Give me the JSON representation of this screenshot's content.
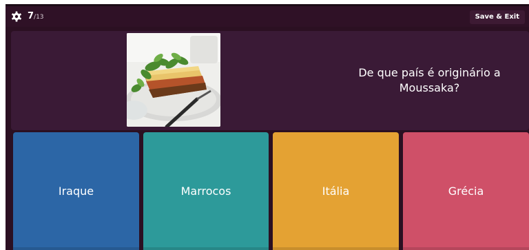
{
  "header": {
    "settings_icon": "gear-icon",
    "progress_current": "7",
    "progress_total": "/13",
    "save_exit_label": "Save & Exit"
  },
  "question": {
    "text": "De que país é originário a Moussaka?",
    "image_icon": "moussaka-food-photo"
  },
  "answers": [
    {
      "label": "Iraque",
      "color": "#2c66a6"
    },
    {
      "label": "Marrocos",
      "color": "#2d9a9a"
    },
    {
      "label": "Itália",
      "color": "#e4a233"
    },
    {
      "label": "Grécia",
      "color": "#cf5068"
    }
  ],
  "colors": {
    "background": "#2b1022",
    "question_panel": "#3a1a36",
    "topbar": "#2f1126"
  }
}
